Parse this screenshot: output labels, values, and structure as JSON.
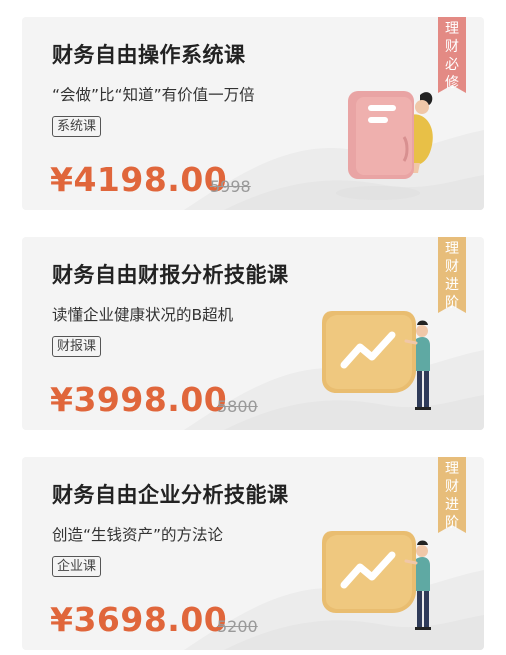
{
  "colors": {
    "price": "#e0663b",
    "ribbon_red": "#e38a84",
    "ribbon_gold": "#e7bd7a",
    "card_bg": "#f4f4f4"
  },
  "courses": [
    {
      "title": "财务自由操作系统课",
      "subtitle": "“会做”比“知道”有价值一万倍",
      "tag": "系统课",
      "price": "¥4198.00",
      "old_price": "5998",
      "ribbon": "理财必修",
      "icon": "document-icon"
    },
    {
      "title": "财务自由财报分析技能课",
      "subtitle": "读懂企业健康状况的B超机",
      "tag": "财报课",
      "price": "¥3998.00",
      "old_price": "5800",
      "ribbon": "理财进阶",
      "icon": "trend-chart-icon"
    },
    {
      "title": "财务自由企业分析技能课",
      "subtitle": "创造“生钱资产”的方法论",
      "tag": "企业课",
      "price": "¥3698.00",
      "old_price": "5200",
      "ribbon": "理财进阶",
      "icon": "trend-chart-icon"
    }
  ]
}
